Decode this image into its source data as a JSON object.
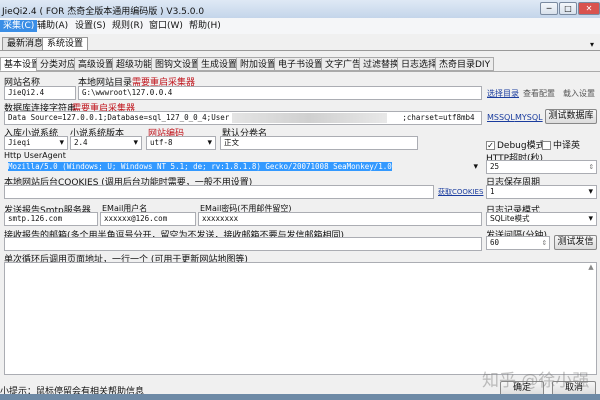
{
  "window": {
    "title": "JieQi2.4 ( FOR 杰奇全版本通用编码版 ) V3.5.0.0",
    "minimize": "─",
    "maximize": "□",
    "close": "✕"
  },
  "menu": [
    "采集(C)",
    "辅助(A)",
    "设置(S)",
    "规则(R)",
    "窗口(W)",
    "帮助(H)"
  ],
  "doc_tabs": [
    "最新消息",
    "系统设置"
  ],
  "tabs": [
    "基本设置",
    "分类对应",
    "高级设置",
    "超级功能",
    "图钩文设置",
    "生成设置",
    "附加设置",
    "电子书设置",
    "文字广告",
    "过滤替换",
    "日志选择",
    "杰奇目录DIY"
  ],
  "form": {
    "site_name_label": "网站名称",
    "site_name": "JieQi2.4",
    "local_dir_label": "本地网站目录",
    "restart_note": "需要重启采集器",
    "local_dir": "G:\\wwwroot\\127.0.0.4",
    "choose_dir": "选择目录",
    "view_config": "查看配置",
    "load_settings": "载入设置",
    "db_label": "数据库连接字符串",
    "db_restart_note": "需要重启采集器",
    "db_string_start": "Data Source=127.0.0.1;Database=sql_127_0_0_4;User ID=",
    "db_string_end": ";charset=utf8mb4",
    "mssql": "MSSQL",
    "mysql": "MYSQL",
    "test_db": "测试数据库",
    "novel_system_label": "入库小说系统",
    "novel_system": "Jieqi",
    "version_label": "小说系统版本",
    "version": "2.4",
    "encoding_label": "网站编码",
    "encoding": "utf-8",
    "volume_label": "默认分卷名",
    "volume": "正文",
    "debug_label": "Debug模式",
    "debug_checked": true,
    "zh_label": "中译英",
    "zh_checked": false,
    "ua_label": "Http UserAgent",
    "ua": "Mozilla/5.0 (Windows; U; Windows NT 5.1; de; rv:1.8.1.8) Gecko/20071008 SeaMonkey/1.0",
    "timeout_label": "HTTP超时(秒)",
    "timeout": "25",
    "cookies_label": "本地网站后台COOKIES (调用后台功能时需要，一般不用设置)",
    "cookies": "",
    "get_cookies": "获取COOKIES",
    "log_period_label": "日志保存周期",
    "log_period": "1",
    "smtp_label": "发送报告Smtp服务器",
    "smtp": "smtp.126.com",
    "email_user_label": "EMail用户名",
    "email_user": "xxxxxx@126.com",
    "email_pass_label": "EMail密码(不用邮件留空)",
    "email_pass": "xxxxxxxx",
    "log_mode_label": "日志记录模式",
    "log_mode": "SQLite模式",
    "receive_label": "接收报告的邮箱(多个用半角逗号分开，留空为不发送，接收邮箱不要与发信邮箱相同)",
    "receive": "",
    "interval_label": "发送间隔(分钟)",
    "interval": "60",
    "test_send": "测试发信",
    "loop_label": "单次循环后调用页面地址，一行一个 (可用于更新网站地图等)",
    "loop_urls": ""
  },
  "status": {
    "tip": "小提示：鼠标停留会有相关帮助信息",
    "ok": "确定",
    "cancel": "取消"
  },
  "watermark": "知乎 @徐小强",
  "colors": {
    "menu_active": "#3a8ee6",
    "note_red": "#c0141c",
    "link": "#1a3c9e",
    "selection": "#3399ff"
  }
}
